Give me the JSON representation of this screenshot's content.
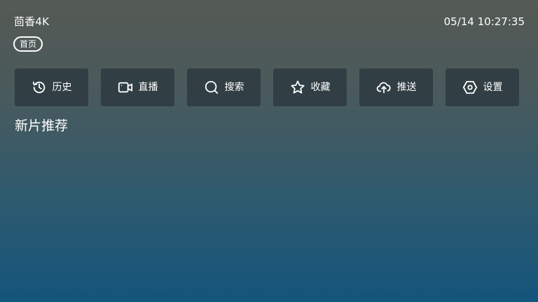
{
  "header": {
    "app_title": "茴香4K",
    "clock": "05/14 10:27:35"
  },
  "nav": {
    "home_tab": "首页"
  },
  "toolbar": {
    "items": [
      {
        "label": "历史",
        "icon": "history-icon"
      },
      {
        "label": "直播",
        "icon": "video-camera-icon"
      },
      {
        "label": "搜索",
        "icon": "search-icon"
      },
      {
        "label": "收藏",
        "icon": "star-icon"
      },
      {
        "label": "推送",
        "icon": "cloud-upload-icon"
      },
      {
        "label": "设置",
        "icon": "settings-hexagon-icon"
      }
    ]
  },
  "main": {
    "section_title": "新片推荐"
  }
}
